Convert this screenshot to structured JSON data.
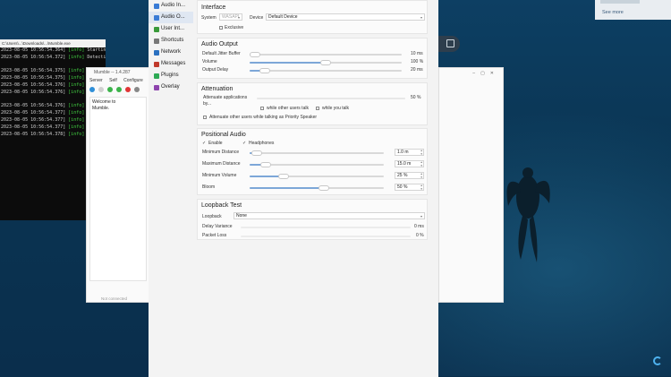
{
  "desktop": {
    "see_more": "See more"
  },
  "console": {
    "title": "C:\\Users\\...\\Downloads\\...\\Mumble.exe",
    "lines": [
      {
        "time": "2023-08-05 10:56:54.364]",
        "level": "[info]",
        "msg": "Starting Humble..."
      },
      {
        "time": "2023-08-05 10:56:54.372]",
        "level": "[info]",
        "msg": "Detecting Humble link..."
      },
      {
        "time": "",
        "level": "",
        "msg": ""
      },
      {
        "time": "2023-08-05 10:56:54.375]",
        "level": "[info]",
        "msg": "Fo"
      },
      {
        "time": "2023-08-05 10:56:54.375]",
        "level": "[info]",
        "msg": ""
      },
      {
        "time": "2023-08-05 10:56:54.376]",
        "level": "[info]",
        "msg": ""
      },
      {
        "time": "2023-08-05 10:56:54.376]",
        "level": "[info]",
        "msg": ""
      },
      {
        "time": "",
        "level": "",
        "msg": ""
      },
      {
        "time": "2023-08-05 10:56:54.376]",
        "level": "[info]",
        "msg": "Fo"
      },
      {
        "time": "2023-08-05 10:56:54.377]",
        "level": "[info]",
        "msg": ""
      },
      {
        "time": "2023-08-05 10:56:54.377]",
        "level": "[info]",
        "msg": ""
      },
      {
        "time": "2023-08-05 10:56:54.377]",
        "level": "[info]",
        "msg": ""
      },
      {
        "time": "2023-08-05 10:56:54.378]",
        "level": "[info]",
        "msg": ""
      }
    ]
  },
  "mumble": {
    "title": "Mumble -- 1.4.287",
    "menu": [
      "Server",
      "Self",
      "Configure"
    ],
    "chat_line1": "Welcome to",
    "chat_line2": "Mumble.",
    "status": "Not connected"
  },
  "settings": {
    "sidebar": [
      {
        "label": "Audio In...",
        "icon": "audio-input-icon",
        "color": "#3a7bd5",
        "selected": false
      },
      {
        "label": "Audio O...",
        "icon": "audio-output-icon",
        "color": "#3a7bd5",
        "selected": true
      },
      {
        "label": "User Int...",
        "icon": "user-interface-icon",
        "color": "#3a9a3a",
        "selected": false
      },
      {
        "label": "Shortcuts",
        "icon": "shortcuts-icon",
        "color": "#777777",
        "selected": false
      },
      {
        "label": "Network",
        "icon": "network-icon",
        "color": "#2a70c0",
        "selected": false
      },
      {
        "label": "Messages",
        "icon": "messages-icon",
        "color": "#c0392b",
        "selected": false
      },
      {
        "label": "Plugins",
        "icon": "plugins-icon",
        "color": "#2eaa55",
        "selected": false
      },
      {
        "label": "Overlay",
        "icon": "overlay-icon",
        "color": "#8e44ad",
        "selected": false
      }
    ],
    "interface": {
      "title": "Interface",
      "system_label": "System",
      "system_value": "WASAPI",
      "device_label": "Device",
      "device_value": "Default Device",
      "exclusive_label": "Exclusive"
    },
    "audio_output": {
      "title": "Audio Output",
      "rows": [
        {
          "label": "Default Jitter Buffer",
          "value": "10 ms",
          "fraction": 0.02
        },
        {
          "label": "Volume",
          "value": "100 %",
          "fraction": 0.5
        },
        {
          "label": "Output Delay",
          "value": "20 ms",
          "fraction": 0.1
        }
      ]
    },
    "attenuation": {
      "title": "Attenuation",
      "attenuate_label1": "Attenuate applications",
      "attenuate_label2": "by...",
      "attenuate_value": "50 %",
      "while_other_label": "while other users talk",
      "while_you_label": "while you talk",
      "priority_label": "Attenuate other users while talking as Priority Speaker"
    },
    "positional": {
      "title": "Positional Audio",
      "enable_label": "Enable",
      "headphones_label": "Headphones",
      "rows": [
        {
          "label": "Minimum Distance",
          "value": "1.0 m",
          "fraction": 0.05
        },
        {
          "label": "Maximum Distance",
          "value": "15.0 m",
          "fraction": 0.12
        },
        {
          "label": "Minimum Volume",
          "value": "25 %",
          "fraction": 0.25
        },
        {
          "label": "Bloom",
          "value": "50 %",
          "fraction": 0.55
        }
      ]
    },
    "loopback": {
      "title": "Loopback Test",
      "loopback_label": "Loopback",
      "loopback_value": "None",
      "delay_label": "Delay Variance",
      "delay_value": "0 ms",
      "loss_label": "Packet Loss",
      "loss_value": "0 %"
    }
  }
}
